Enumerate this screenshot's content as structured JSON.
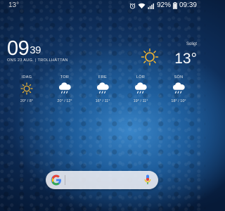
{
  "status_bar": {
    "notification_temp": "13°",
    "battery_percent": "92%",
    "time": "09:39",
    "icons": [
      "alarm-icon",
      "wifi-icon",
      "signal-icon",
      "battery-icon"
    ]
  },
  "clock": {
    "hours": "09",
    "minutes": "39",
    "date_location": "ONS 23 AUG. | TROLLHÄTTAN"
  },
  "current_weather": {
    "condition": "Soligt",
    "temperature": "13°",
    "icon": "sun-icon"
  },
  "forecast": [
    {
      "day": "IDAG",
      "range": "20° / 8°",
      "icon": "sun-icon"
    },
    {
      "day": "TOR",
      "range": "20° / 12°",
      "icon": "rain-cloud-icon"
    },
    {
      "day": "FRE",
      "range": "16° / 11°",
      "icon": "rain-cloud-icon"
    },
    {
      "day": "LÖR",
      "range": "19° / 11°",
      "icon": "rain-cloud-icon"
    },
    {
      "day": "SÖN",
      "range": "18° / 10°",
      "icon": "rain-cloud-icon"
    }
  ],
  "search_bar": {
    "logo": "google-g-icon",
    "mic": "mic-icon"
  },
  "colors": {
    "sun": "#f2b632",
    "google_blue": "#4285f4",
    "google_red": "#ea4335",
    "google_yellow": "#fbbc05",
    "google_green": "#34a853"
  }
}
